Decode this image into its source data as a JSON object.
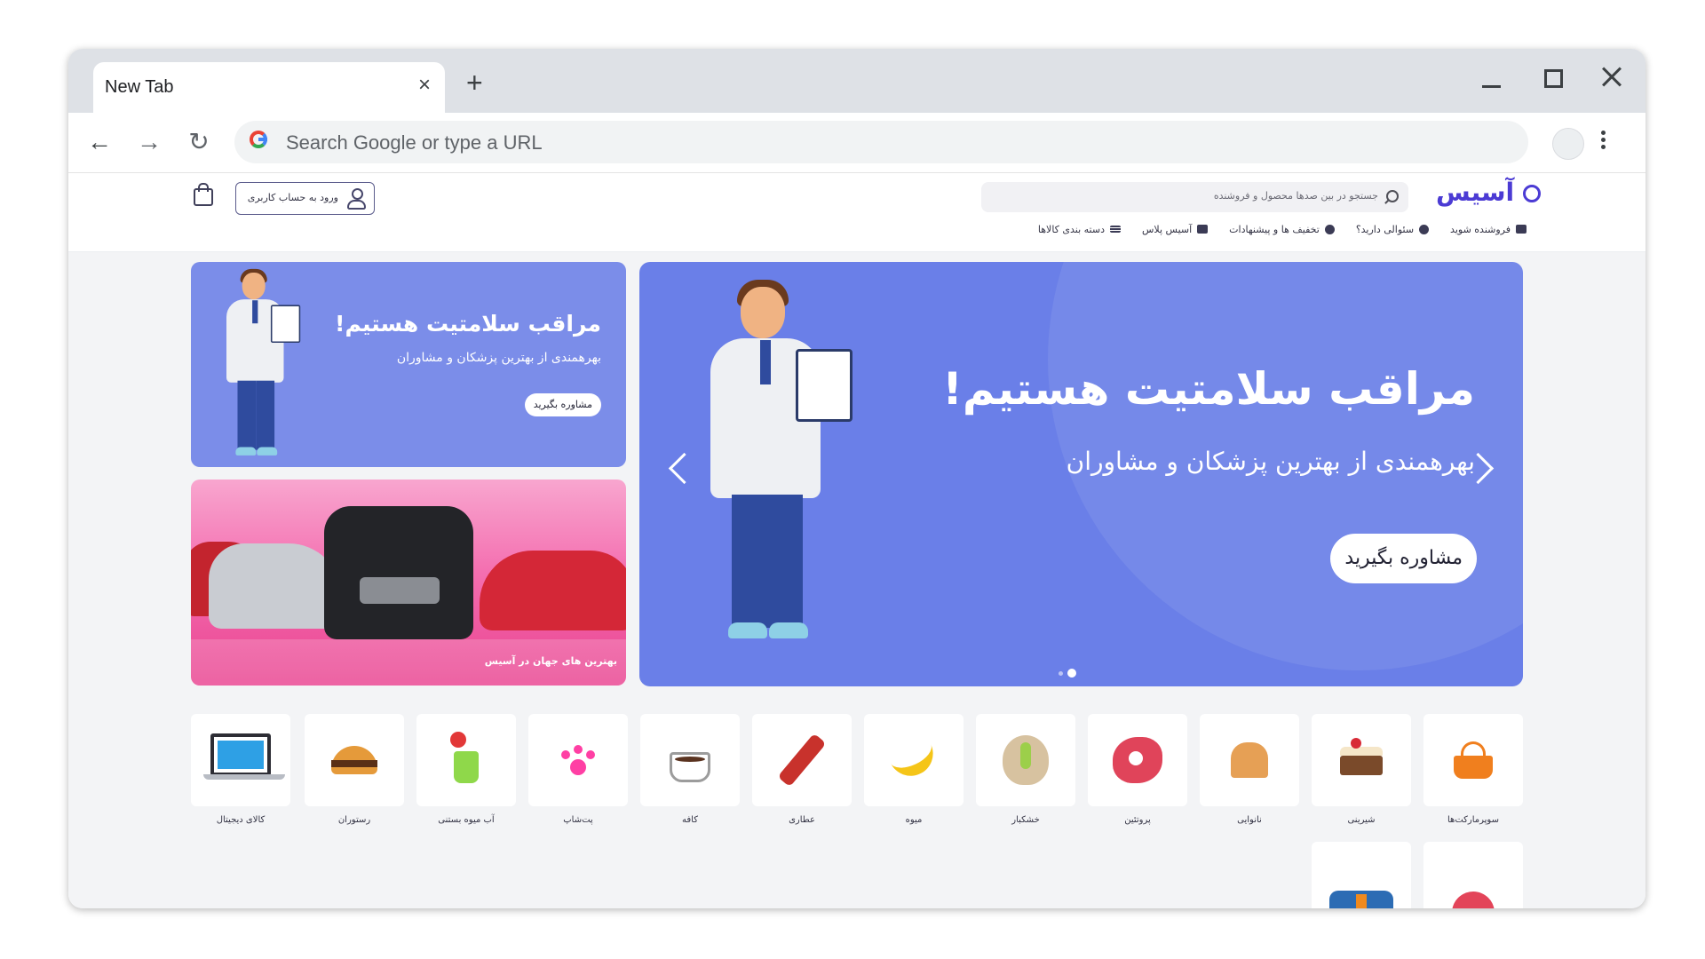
{
  "browser": {
    "tab_title": "New Tab",
    "tab_close": "×",
    "new_tab": "+",
    "omnibox_placeholder": "Search Google or type a URL",
    "nav_back": "←",
    "nav_forward": "→",
    "nav_reload": "↻"
  },
  "site": {
    "logo_text": "آسیس",
    "search_placeholder": "جستجو در بین صدها محصول و فروشنده",
    "login_label": "ورود به حساب کاربری",
    "menu": [
      {
        "label": "دسته بندی کالاها",
        "icon": "menu-icon"
      },
      {
        "label": "آسیس پلاس",
        "icon": "truck-icon"
      },
      {
        "label": "تخفیف ها و پیشنهادات",
        "icon": "discount-icon"
      },
      {
        "label": "سئوالی دارید؟",
        "icon": "question-icon"
      },
      {
        "label": "فروشنده شوید",
        "icon": "store-icon"
      }
    ]
  },
  "banners": {
    "main": {
      "title": "مراقب سلامتیت هستیم!",
      "subtitle": "بهرهمندی از بهترین پزشکان و مشاوران",
      "button": "مشاوره بگیرید",
      "slide_count": 2,
      "active_slide": 2
    },
    "side_top": {
      "title": "مراقب سلامتیت هستیم!",
      "subtitle": "بهرهمندی از بهترین پزشکان و مشاوران",
      "button": "مشاوره بگیرید"
    },
    "side_bottom": {
      "caption": "بهترین های جهان در آسیس"
    }
  },
  "categories": [
    {
      "label": "سوپرمارکت‌ها",
      "icon": "basket-icon"
    },
    {
      "label": "شیرینی",
      "icon": "cake-icon"
    },
    {
      "label": "نانوایی",
      "icon": "bread-icon"
    },
    {
      "label": "پروتئین",
      "icon": "meat-icon"
    },
    {
      "label": "خشکبار",
      "icon": "pistachio-icon"
    },
    {
      "label": "میوه",
      "icon": "banana-icon"
    },
    {
      "label": "عطاری",
      "icon": "spice-icon"
    },
    {
      "label": "کافه",
      "icon": "coffee-cup-icon"
    },
    {
      "label": "پت‌شاپ",
      "icon": "paw-icon"
    },
    {
      "label": "آب میوه بستنی",
      "icon": "juice-icon"
    },
    {
      "label": "رستوران",
      "icon": "burger-icon"
    },
    {
      "label": "کالای دیجیتال",
      "icon": "laptop-icon"
    }
  ],
  "categories_row2": [
    {
      "label": "",
      "icon": "shirt-icon"
    },
    {
      "label": "",
      "icon": "lips-icon"
    }
  ]
}
